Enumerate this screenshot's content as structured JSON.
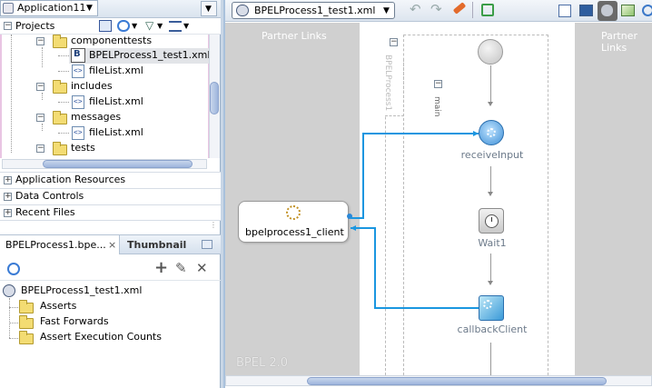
{
  "app_selector": {
    "label": "Application11"
  },
  "projects": {
    "header": "Projects",
    "tree": [
      {
        "label": "componenttests",
        "kind": "folder"
      },
      {
        "label": "BPELProcess1_test1.xml",
        "kind": "bpel",
        "selected": true
      },
      {
        "label": "fileList.xml",
        "kind": "xml"
      },
      {
        "label": "includes",
        "kind": "folder"
      },
      {
        "label": "fileList.xml",
        "kind": "xml"
      },
      {
        "label": "messages",
        "kind": "folder"
      },
      {
        "label": "fileList.xml",
        "kind": "xml"
      },
      {
        "label": "tests",
        "kind": "folder"
      }
    ]
  },
  "accordion": [
    {
      "label": "Application Resources"
    },
    {
      "label": "Data Controls"
    },
    {
      "label": "Recent Files"
    }
  ],
  "bottom_panel": {
    "tabs": [
      {
        "label": "BPELProcess1.bpe...",
        "active": true,
        "close": "×"
      },
      {
        "label": "Thumbnail",
        "active": false
      }
    ],
    "root_label": "BPELProcess1_test1.xml",
    "items": [
      {
        "label": "Asserts"
      },
      {
        "label": "Fast Forwards"
      },
      {
        "label": "Assert Execution Counts"
      }
    ]
  },
  "editor": {
    "file_dropdown": "BPELProcess1_test1.xml",
    "lane_left": "Partner Links",
    "lane_right": "Partner Links",
    "process_label": "BPELProcess1",
    "scope_label": "main",
    "partner_link": "bpelprocess1_client",
    "activities": [
      {
        "label": "receiveInput",
        "icon": "receive-icon"
      },
      {
        "label": "Wait1",
        "icon": "clock-icon"
      },
      {
        "label": "callbackClient",
        "icon": "invoke-icon"
      }
    ],
    "watermark": "BPEL 2.0"
  },
  "colors": {
    "link": "#1a96e0",
    "lane": "#d0d0d0",
    "node_blue": "#5b8fc6",
    "selection": "#e2e4e8"
  }
}
